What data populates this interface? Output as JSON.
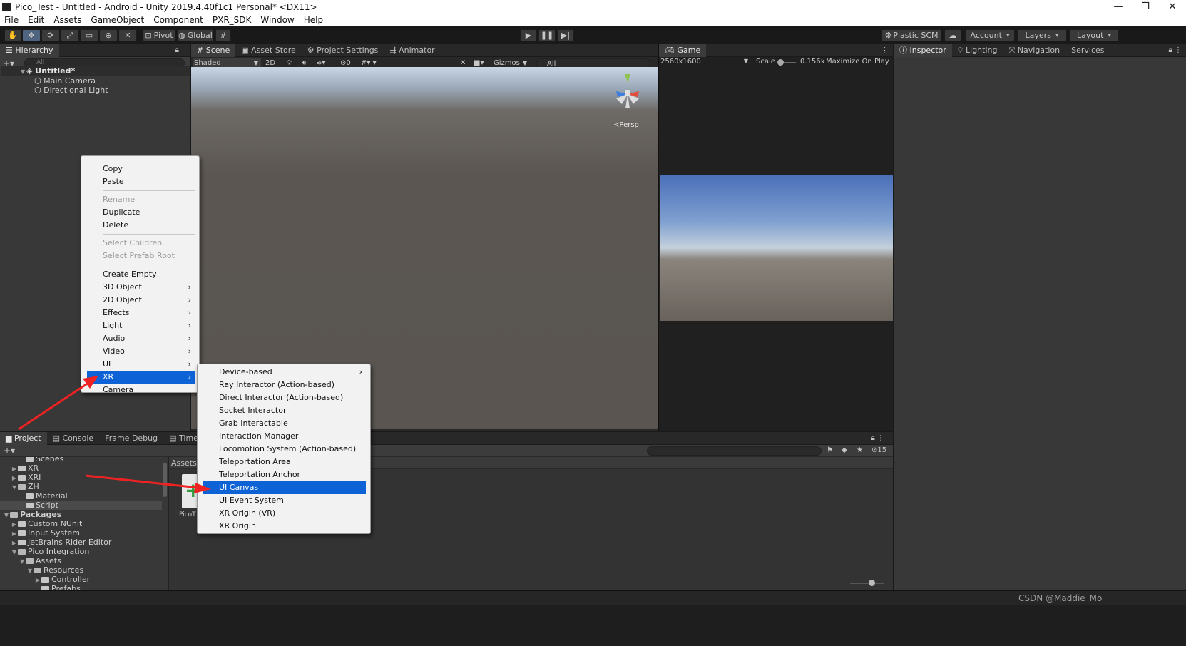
{
  "window": {
    "title": "Pico_Test - Untitled - Android - Unity 2019.4.40f1c1 Personal* <DX11>",
    "buttons": [
      "—",
      "❐",
      "✕"
    ]
  },
  "menubar": [
    "File",
    "Edit",
    "Assets",
    "GameObject",
    "Component",
    "PXR_SDK",
    "Window",
    "Help"
  ],
  "toolbar": {
    "pivot": "Pivot",
    "global": "Global",
    "plastic": "Plastic SCM",
    "account": "Account",
    "layers": "Layers",
    "layout": "Layout"
  },
  "hierarchy": {
    "tab": "Hierarchy",
    "search_placeholder": "All",
    "scene": "Untitled*",
    "items": [
      "Main Camera",
      "Directional Light"
    ]
  },
  "scene": {
    "tabs": [
      "Scene",
      "Asset Store",
      "Project Settings",
      "Animator"
    ],
    "shading": "Shaded",
    "mode2d": "2D",
    "fx_count": "0",
    "gizmos": "Gizmos",
    "search_placeholder": "All",
    "persp": "Persp"
  },
  "game": {
    "tab": "Game",
    "resolution": "2560x1600",
    "scale_label": "Scale",
    "scale_value": "0.156x",
    "maximize": "Maximize On Play"
  },
  "inspector": {
    "tabs": [
      "Inspector",
      "Lighting",
      "Navigation",
      "Services"
    ]
  },
  "project": {
    "tabs": [
      "Project",
      "Console",
      "Frame Debug",
      "Timeline"
    ],
    "hidden_count": "15",
    "breadcrumb": "Assets",
    "asset_label": "PicoT",
    "tree": [
      {
        "label": "Scenes",
        "indent": 2
      },
      {
        "label": "XR",
        "indent": 1
      },
      {
        "label": "XRI",
        "indent": 1
      },
      {
        "label": "ZH",
        "indent": 1
      },
      {
        "label": "Material",
        "indent": 2
      },
      {
        "label": "Script",
        "indent": 2
      },
      {
        "label": "Packages",
        "indent": 0
      },
      {
        "label": "Custom NUnit",
        "indent": 1
      },
      {
        "label": "Input System",
        "indent": 1
      },
      {
        "label": "JetBrains Rider Editor",
        "indent": 1
      },
      {
        "label": "Pico Integration",
        "indent": 1
      },
      {
        "label": "Assets",
        "indent": 2
      },
      {
        "label": "Resources",
        "indent": 3
      },
      {
        "label": "Controller",
        "indent": 4
      },
      {
        "label": "Prefabs",
        "indent": 4
      }
    ]
  },
  "context_menu": {
    "items": [
      {
        "label": "Copy",
        "disabled": false
      },
      {
        "label": "Paste",
        "disabled": false
      },
      {
        "label": "Rename",
        "disabled": true
      },
      {
        "label": "Duplicate",
        "disabled": false
      },
      {
        "label": "Delete",
        "disabled": false
      },
      {
        "label": "Select Children",
        "disabled": true
      },
      {
        "label": "Select Prefab Root",
        "disabled": true
      },
      {
        "label": "Create Empty",
        "disabled": false
      },
      {
        "label": "3D Object",
        "submenu": true
      },
      {
        "label": "2D Object",
        "submenu": true
      },
      {
        "label": "Effects",
        "submenu": true
      },
      {
        "label": "Light",
        "submenu": true
      },
      {
        "label": "Audio",
        "submenu": true
      },
      {
        "label": "Video",
        "submenu": true
      },
      {
        "label": "UI",
        "submenu": true
      },
      {
        "label": "XR",
        "submenu": true,
        "selected": true
      },
      {
        "label": "Camera",
        "disabled": false
      }
    ]
  },
  "xr_submenu": {
    "items": [
      {
        "label": "Device-based",
        "submenu": true
      },
      {
        "label": "Ray Interactor (Action-based)"
      },
      {
        "label": "Direct Interactor (Action-based)"
      },
      {
        "label": "Socket Interactor"
      },
      {
        "label": "Grab Interactable"
      },
      {
        "label": "Interaction Manager"
      },
      {
        "label": "Locomotion System (Action-based)"
      },
      {
        "label": "Teleportation Area"
      },
      {
        "label": "Teleportation Anchor"
      },
      {
        "label": "UI Canvas",
        "selected": true
      },
      {
        "label": "UI Event System"
      },
      {
        "label": "XR Origin (VR)"
      },
      {
        "label": "XR Origin"
      }
    ]
  },
  "watermark": "CSDN @Maddie_Mo",
  "colors": {
    "highlight": "#0d62d6",
    "annotation_arrow": "#ee2222"
  }
}
